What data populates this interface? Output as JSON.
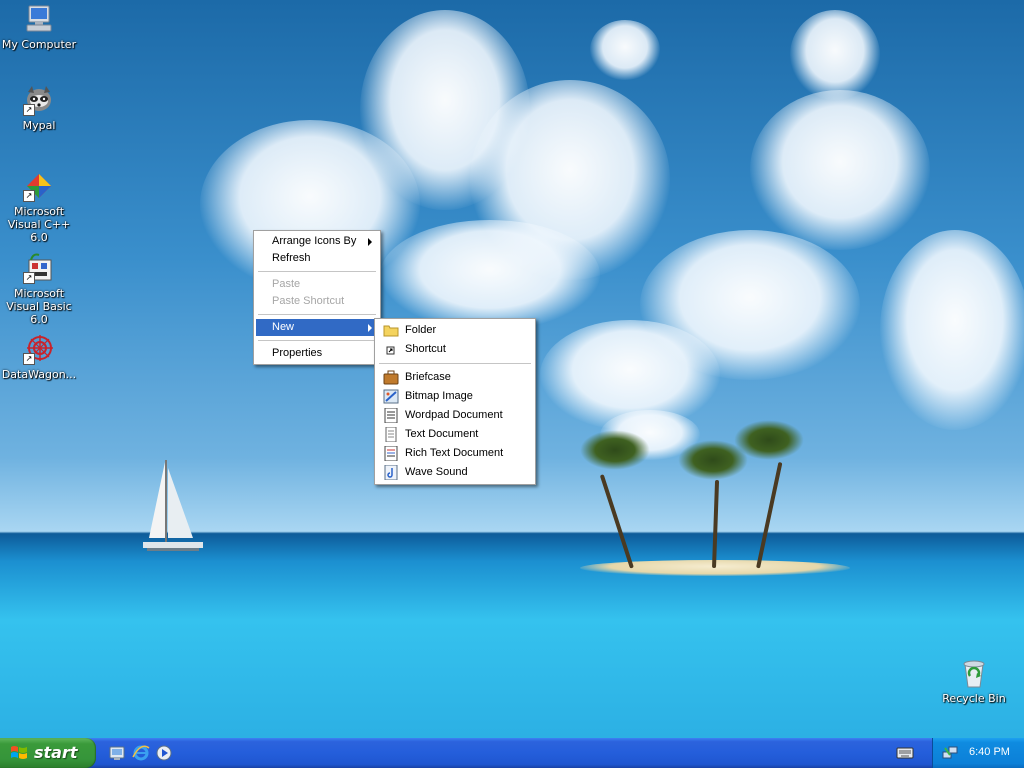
{
  "desktop_icons": [
    {
      "label": "My Computer",
      "icon": "my-computer-icon"
    },
    {
      "label": "Mypal",
      "icon": "raccoon-icon"
    },
    {
      "label": "Microsoft Visual C++ 6.0",
      "icon": "visual-cpp-icon"
    },
    {
      "label": "Microsoft Visual Basic 6.0",
      "icon": "visual-basic-icon"
    },
    {
      "label": "DataWagon...",
      "icon": "datawagon-icon"
    },
    {
      "label": "Recycle Bin",
      "icon": "recycle-bin-icon"
    }
  ],
  "context_menu": {
    "items": [
      {
        "label": "Arrange Icons By"
      },
      {
        "label": "Refresh"
      },
      {
        "label": "Paste"
      },
      {
        "label": "Paste Shortcut"
      },
      {
        "label": "New"
      },
      {
        "label": "Properties"
      }
    ]
  },
  "new_submenu": {
    "items": [
      {
        "label": "Folder",
        "icon": "folder-icon"
      },
      {
        "label": "Shortcut",
        "icon": "shortcut-icon"
      },
      {
        "label": "Briefcase",
        "icon": "briefcase-icon"
      },
      {
        "label": "Bitmap Image",
        "icon": "bitmap-icon"
      },
      {
        "label": "Wordpad Document",
        "icon": "wordpad-icon"
      },
      {
        "label": "Text Document",
        "icon": "text-document-icon"
      },
      {
        "label": "Rich Text Document",
        "icon": "rich-text-icon"
      },
      {
        "label": "Wave Sound",
        "icon": "wave-sound-icon"
      }
    ]
  },
  "taskbar": {
    "start_label": "start",
    "clock": "6:40 PM"
  },
  "colors": {
    "menu_highlight": "#316ac5",
    "taskbar_blue": "#245edb",
    "start_green": "#36953a",
    "tray_blue": "#0c80d8"
  }
}
